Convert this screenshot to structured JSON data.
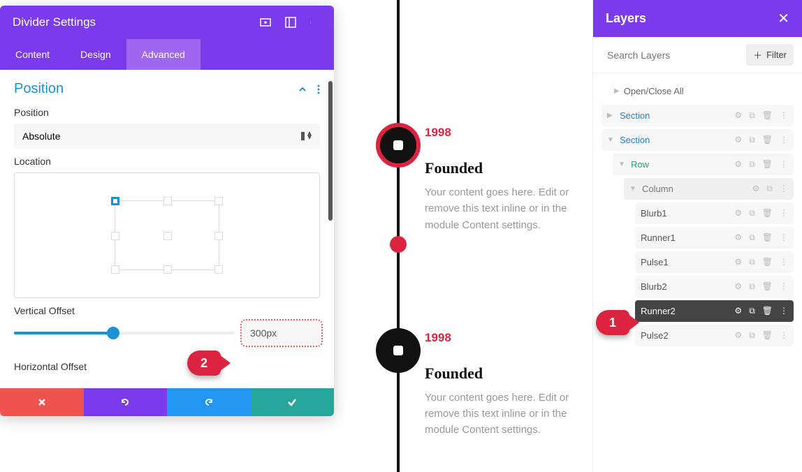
{
  "settings": {
    "title": "Divider Settings",
    "tabs": {
      "content": "Content",
      "design": "Design",
      "advanced": "Advanced"
    },
    "section": {
      "title": "Position"
    },
    "position": {
      "label": "Position",
      "value": "Absolute"
    },
    "location": {
      "label": "Location"
    },
    "vOffset": {
      "label": "Vertical Offset",
      "value": "300px"
    },
    "hOffset": {
      "label": "Horizontal Offset"
    }
  },
  "preview": {
    "items": [
      {
        "year": "1998",
        "title": "Founded",
        "text": "Your content goes here. Edit or remove this text inline or in the module Content settings."
      },
      {
        "year": "1998",
        "title": "Founded",
        "text": "Your content goes here. Edit or remove this text inline or in the module Content settings."
      }
    ]
  },
  "layers": {
    "title": "Layers",
    "searchPlaceholder": "Search Layers",
    "filterLabel": "Filter",
    "openClose": "Open/Close All",
    "tree": {
      "section1": "Section",
      "section2": "Section",
      "row": "Row",
      "column": "Column",
      "modules": [
        "Blurb1",
        "Runner1",
        "Pulse1",
        "Blurb2",
        "Runner2",
        "Pulse2"
      ]
    }
  },
  "callouts": {
    "c1": "1",
    "c2": "2"
  }
}
